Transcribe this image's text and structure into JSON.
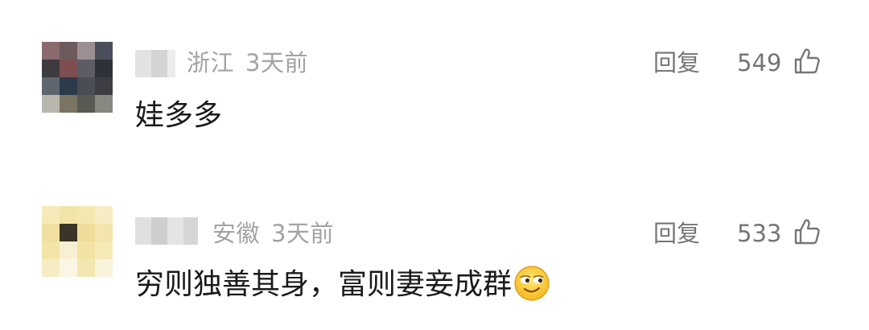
{
  "comments": [
    {
      "location": "浙江",
      "time": "3天前",
      "reply_label": "回复",
      "likes": "549",
      "text": "娃多多",
      "emoji": null
    },
    {
      "location": "安徽",
      "time": "3天前",
      "reply_label": "回复",
      "likes": "533",
      "text": "穷则独善其身，富则妻妾成群",
      "emoji": "smug-smile-emoji"
    }
  ],
  "icons": {
    "like": "thumbs-up-icon"
  },
  "colors": {
    "meta_text": "#a3a3a3",
    "action_text": "#757575",
    "body_text": "#1a1a1a"
  }
}
